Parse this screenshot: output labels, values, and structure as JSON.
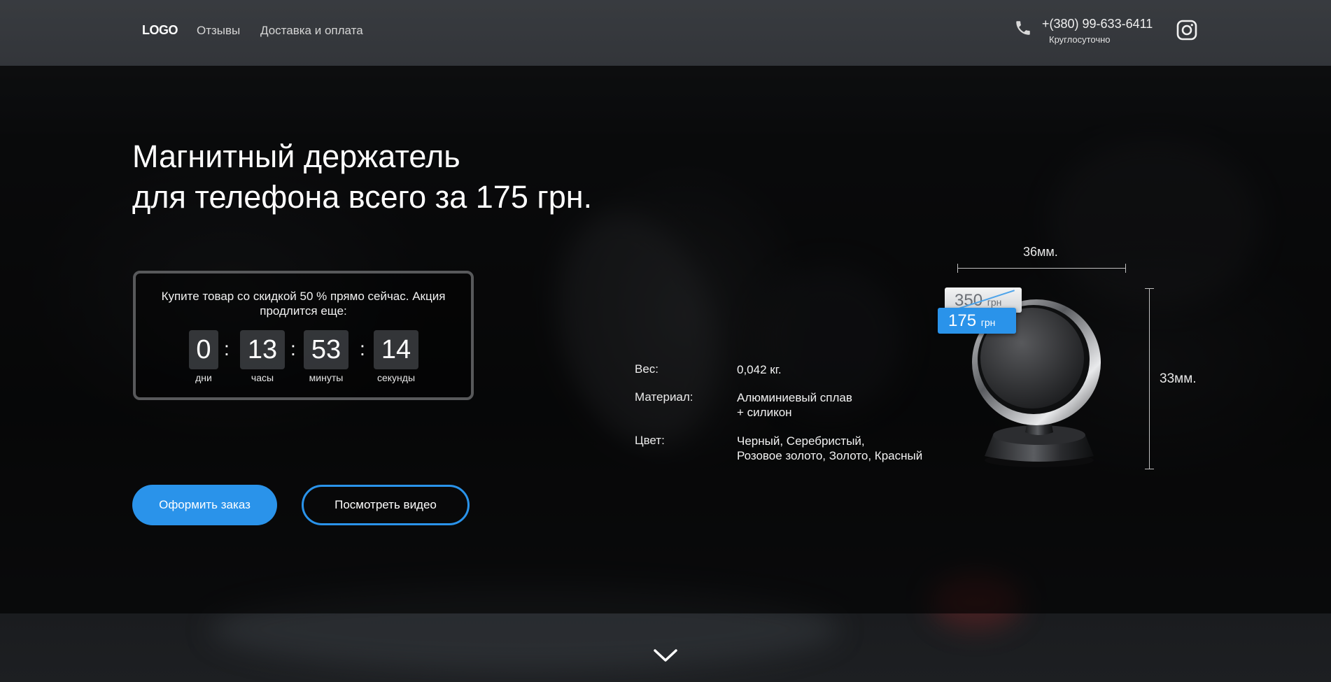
{
  "header": {
    "logo": "LOGO",
    "nav": [
      "Отзывы",
      "Доставка и оплата"
    ],
    "phone": "+(380) 99-633-6411",
    "phone_hours": "Круглосуточно"
  },
  "hero": {
    "title_line1": "Магнитный держатель",
    "title_line2": "для телефона всего за 175 грн."
  },
  "timer": {
    "text": "Купите товар со скидкой 50 % прямо сейчас. Акция продлится еще:",
    "days": "0",
    "hours": "13",
    "minutes": "53",
    "seconds": "14",
    "days_label": "дни",
    "hours_label": "часы",
    "minutes_label": "минуты",
    "seconds_label": "секунды",
    "separator": ":"
  },
  "buttons": {
    "order": "Оформить заказ",
    "video": "Посмотреть видео"
  },
  "specs": {
    "weight_label": "Вес:",
    "weight_value": "0,042 кг.",
    "material_label": "Материал:",
    "material_value_line1": "Алюминиевый сплав",
    "material_value_line2": "+ силикон",
    "color_label": "Цвет:",
    "color_value_line1": "Черный, Серебристый,",
    "color_value_line2": "Розовое золото, Золото, Красный"
  },
  "product": {
    "width_label": "36мм.",
    "height_label": "33мм.",
    "old_price": "350",
    "old_price_unit": "грн",
    "new_price": "175",
    "new_price_unit": "грн"
  },
  "colors": {
    "accent": "#2a93ea"
  }
}
